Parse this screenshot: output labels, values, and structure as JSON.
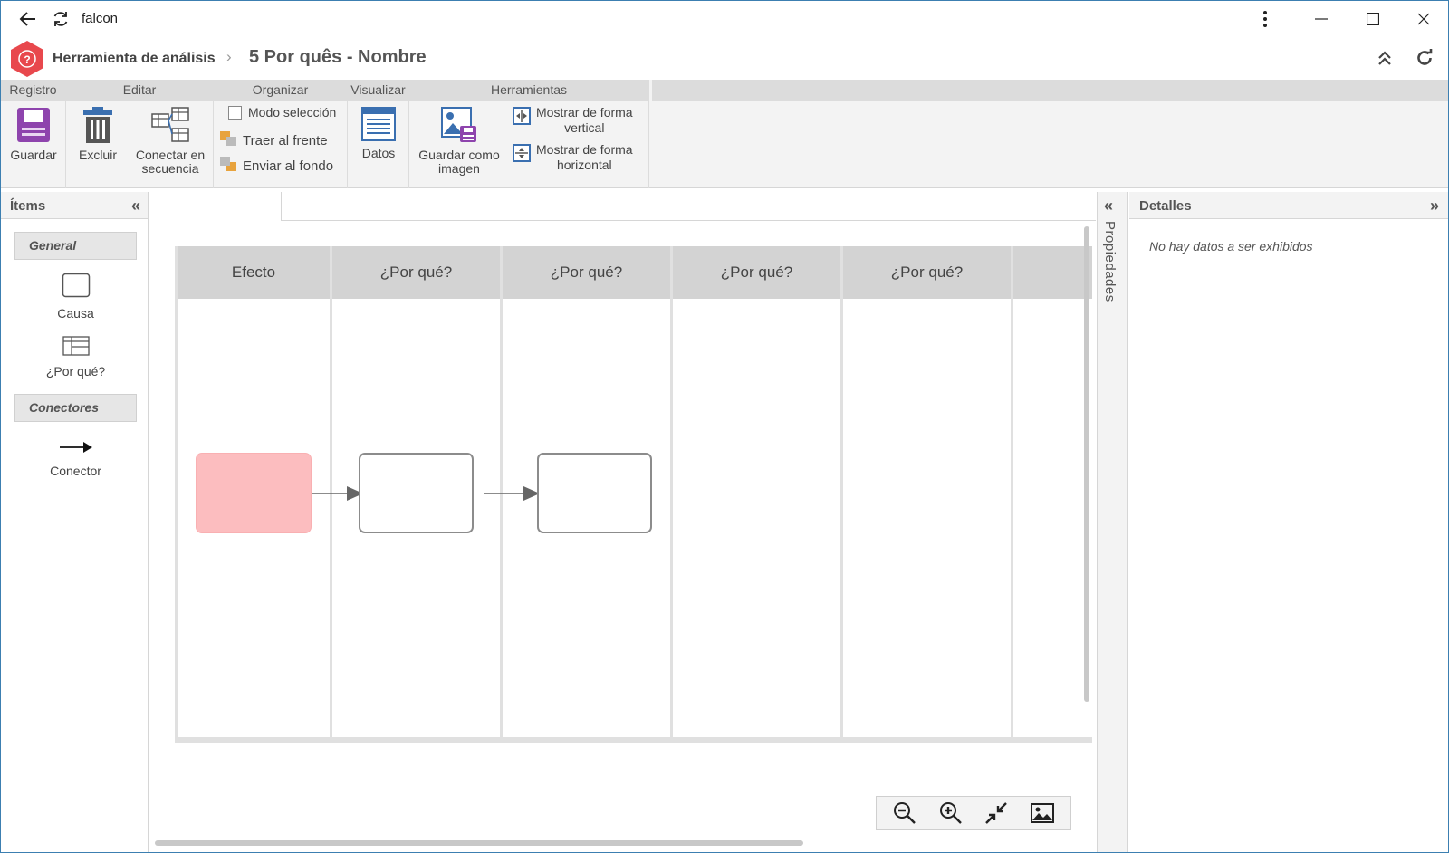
{
  "titlebar": {
    "title": "falcon",
    "icons": [
      "back-arrow-icon",
      "refresh-icon",
      "more-vertical-icon",
      "minimize-icon",
      "maximize-icon",
      "close-icon"
    ]
  },
  "header": {
    "app_name": "Herramienta de análisis",
    "separator": "›",
    "doc_title": "5 Por quês - Nombre"
  },
  "ribbon": {
    "groups": {
      "registro": "Registro",
      "editar": "Editar",
      "organizar": "Organizar",
      "visualizar": "Visualizar",
      "herramientas": "Herramientas"
    },
    "buttons": {
      "guardar": "Guardar",
      "excluir": "Excluir",
      "conectar_1": "Conectar en",
      "conectar_2": "secuencia",
      "modo_seleccion": "Modo selección",
      "traer_frente": "Traer al frente",
      "enviar_fondo": "Enviar al fondo",
      "datos": "Datos",
      "guardar_imagen_1": "Guardar como",
      "guardar_imagen_2": "imagen",
      "vertical_1": "Mostrar de forma",
      "vertical_2": "vertical",
      "horizontal_1": "Mostrar de forma",
      "horizontal_2": "horizontal"
    }
  },
  "left_panel": {
    "title": "Ítems",
    "sections": {
      "general": "General",
      "conectores": "Conectores"
    },
    "items": {
      "causa": "Causa",
      "por_que": "¿Por qué?",
      "conector": "Conector"
    }
  },
  "diagram": {
    "columns": [
      "Efecto",
      "¿Por qué?",
      "¿Por qué?",
      "¿Por qué?",
      "¿Por qué?"
    ],
    "colors": {
      "effect_fill": "#fcbdbf",
      "header_fill": "#d3d3d3",
      "node_border": "#8c8c8c"
    }
  },
  "right_panel": {
    "properties_label": "Propiedades",
    "details_title": "Detalles",
    "details_empty": "No hay datos a ser exhibidos"
  },
  "colors": {
    "window_border": "#3c7fb1",
    "logo": "#e8484d",
    "accent_purple": "#8e44ad",
    "accent_blue": "#3a6fb0"
  }
}
